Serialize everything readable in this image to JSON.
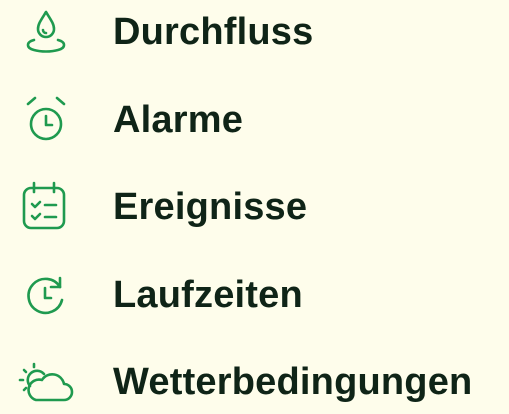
{
  "colors": {
    "background": "#fefdeb",
    "icon": "#1f9a4f",
    "text": "#0f2417"
  },
  "menu": {
    "items": [
      {
        "label": "Durchfluss",
        "icon": "water-drop-icon"
      },
      {
        "label": "Alarme",
        "icon": "alarm-clock-icon"
      },
      {
        "label": "Ereignisse",
        "icon": "calendar-checklist-icon"
      },
      {
        "label": "Laufzeiten",
        "icon": "clock-refresh-icon"
      },
      {
        "label": "Wetterbedingungen",
        "icon": "sun-cloud-icon"
      }
    ]
  }
}
